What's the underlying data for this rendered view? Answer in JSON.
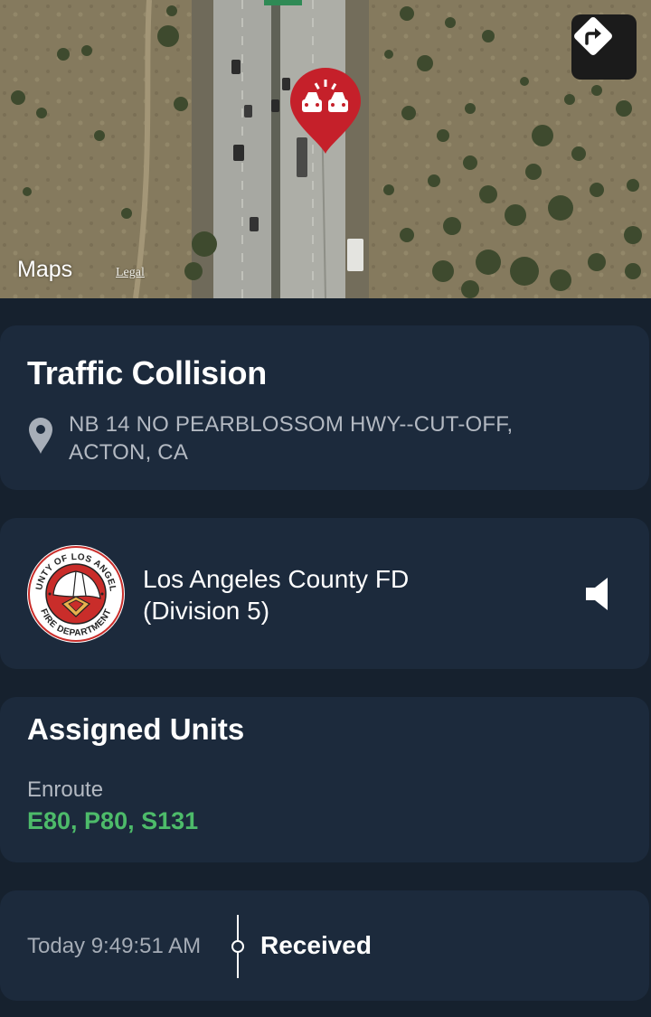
{
  "map": {
    "provider": "Maps",
    "legal_link": "Legal",
    "marker_icon": "car-collision-icon",
    "marker_color": "#c5202a",
    "directions_icon": "directions-icon"
  },
  "incident": {
    "title": "Traffic Collision",
    "address_line1": "NB 14 NO PEARBLOSSOM HWY--CUT-OFF,",
    "address_line2": "ACTON, CA",
    "location_icon": "location-pin-icon"
  },
  "agency": {
    "name_line1": "Los Angeles County FD",
    "name_line2": "(Division 5)",
    "logo_text_top": "COUNTY OF LOS ANGELES",
    "logo_text_bottom": "FIRE DEPARTMENT",
    "speaker_icon": "speaker-icon"
  },
  "units": {
    "title": "Assigned Units",
    "status": "Enroute",
    "list": "E80, P80, S131",
    "status_color": "#4dbb6a"
  },
  "timeline": {
    "time": "Today 9:49:51 AM",
    "status": "Received"
  },
  "colors": {
    "background": "#16212e",
    "card": "#1c2a3c",
    "accent_green": "#4dbb6a",
    "marker_red": "#c5202a"
  }
}
